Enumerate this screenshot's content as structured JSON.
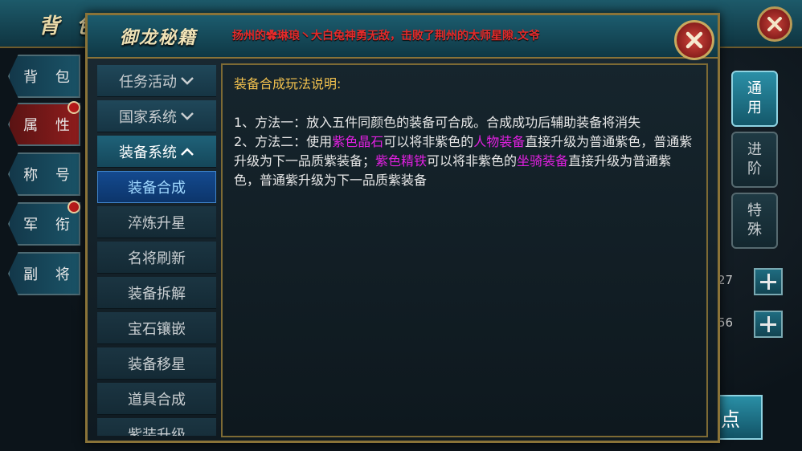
{
  "background": {
    "title": "背 包",
    "left_tabs": [
      "背 包",
      "属 性",
      "称 号",
      "军 衔",
      "副 将"
    ],
    "right_tabs": [
      "通\n用",
      "进\n阶",
      "特\n殊"
    ],
    "values": [
      "27",
      "56"
    ],
    "bottom_button": "点"
  },
  "dialog": {
    "title": "御龙秘籍",
    "marquee": "扬州的✿琳琅丶大白兔神勇无敌，击败了荆州的太师星隙.文爷"
  },
  "menu": {
    "items": [
      {
        "label": "任务活动",
        "kind": "category",
        "state": "collapsed"
      },
      {
        "label": "国家系统",
        "kind": "category",
        "state": "collapsed"
      },
      {
        "label": "装备系统",
        "kind": "category",
        "state": "expanded"
      },
      {
        "label": "装备合成",
        "kind": "sub",
        "state": "selected"
      },
      {
        "label": "淬炼升星",
        "kind": "sub"
      },
      {
        "label": "名将刷新",
        "kind": "sub"
      },
      {
        "label": "装备拆解",
        "kind": "sub"
      },
      {
        "label": "宝石镶嵌",
        "kind": "sub"
      },
      {
        "label": "装备移星",
        "kind": "sub"
      },
      {
        "label": "道具合成",
        "kind": "sub"
      },
      {
        "label": "紫装升级",
        "kind": "sub"
      }
    ]
  },
  "content": {
    "title": "装备合成玩法说明:",
    "line1": "1、方法一：放入五件同颜色的装备可合成。合成成功后辅助装备将消失",
    "line2": {
      "p1": "2、方法二：使用",
      "h1": "紫色晶石",
      "p2": "可以将非紫色的",
      "h2": "人物装备",
      "p3": "直接升级为普通紫色，普通紫升级为下一品质紫装备；",
      "h3": "紫色精铁",
      "p4": "可以将非紫色的",
      "h4": "坐骑装备",
      "p5": "直接升级为普通紫色，普通紫升级为下一品质紫装备"
    }
  },
  "colors": {
    "highlight": "#e020e0",
    "title_gold": "#f2c14e",
    "marquee_red": "#e32b2b"
  }
}
